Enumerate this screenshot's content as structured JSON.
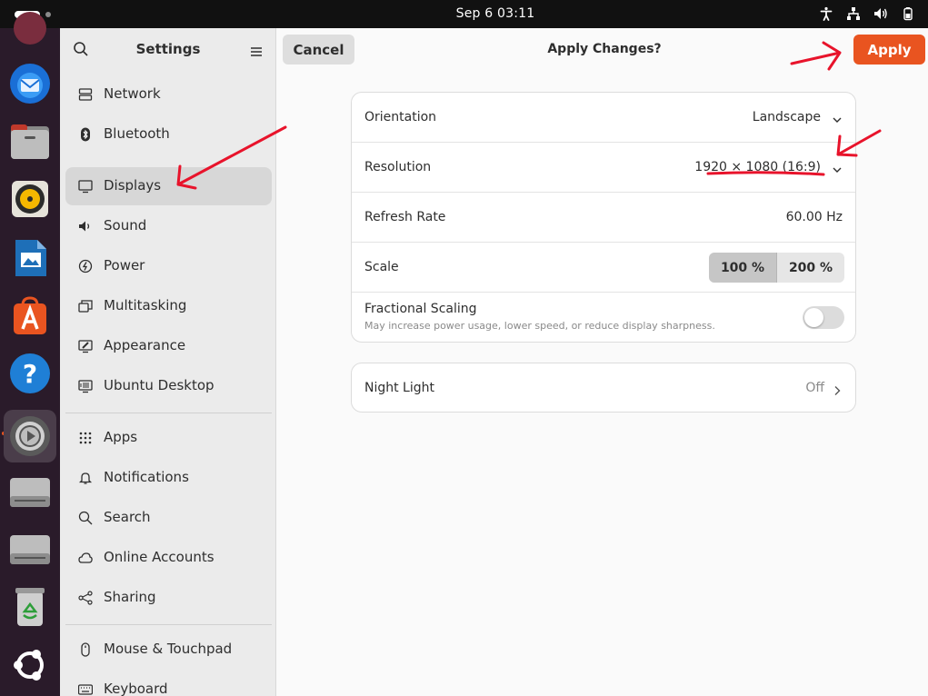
{
  "topbar": {
    "clock": "Sep 6  03:11"
  },
  "dock": {
    "items": [
      {
        "icon": "thunderbird-icon"
      },
      {
        "icon": "files-icon"
      },
      {
        "icon": "rhythmbox-icon"
      },
      {
        "icon": "libreoffice-writer-icon"
      },
      {
        "icon": "app-center-icon"
      },
      {
        "icon": "help-icon"
      },
      {
        "icon": "settings-icon"
      },
      {
        "icon": "drive-icon"
      },
      {
        "icon": "drive-icon"
      },
      {
        "icon": "trash-icon"
      },
      {
        "icon": "ubuntu-logo-icon"
      }
    ]
  },
  "sidebar": {
    "title": "Settings",
    "items": [
      {
        "label": "Network",
        "icon": "network-icon"
      },
      {
        "label": "Bluetooth",
        "icon": "bluetooth-icon"
      },
      {
        "label": "Displays",
        "icon": "display-icon",
        "selected": true
      },
      {
        "label": "Sound",
        "icon": "sound-icon"
      },
      {
        "label": "Power",
        "icon": "power-icon"
      },
      {
        "label": "Multitasking",
        "icon": "multitasking-icon"
      },
      {
        "label": "Appearance",
        "icon": "appearance-icon"
      },
      {
        "label": "Ubuntu Desktop",
        "icon": "ubuntu-desktop-icon"
      },
      {
        "label": "Apps",
        "icon": "apps-icon"
      },
      {
        "label": "Notifications",
        "icon": "bell-icon"
      },
      {
        "label": "Search",
        "icon": "search-icon"
      },
      {
        "label": "Online Accounts",
        "icon": "cloud-icon"
      },
      {
        "label": "Sharing",
        "icon": "share-icon"
      },
      {
        "label": "Mouse & Touchpad",
        "icon": "mouse-icon"
      },
      {
        "label": "Keyboard",
        "icon": "keyboard-icon"
      }
    ]
  },
  "header": {
    "cancel_label": "Cancel",
    "title": "Apply Changes?",
    "apply_label": "Apply"
  },
  "display": {
    "orientation": {
      "label": "Orientation",
      "value": "Landscape"
    },
    "resolution": {
      "label": "Resolution",
      "value": "1920 × 1080 (16:9)"
    },
    "refresh_rate": {
      "label": "Refresh Rate",
      "value": "60.00 Hz"
    },
    "scale": {
      "label": "Scale",
      "options": [
        "100 %",
        "200 %"
      ],
      "selected": "100 %"
    },
    "fractional_scaling": {
      "label": "Fractional Scaling",
      "description": "May increase power usage, lower speed, or reduce display sharpness.",
      "enabled": false
    },
    "night_light": {
      "label": "Night Light",
      "value": "Off"
    }
  },
  "colors": {
    "accent": "#e95420",
    "annotation": "#e8132b"
  }
}
